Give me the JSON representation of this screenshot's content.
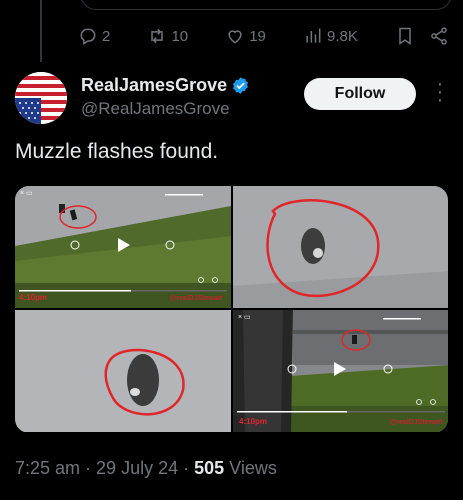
{
  "previous_tweet": {
    "actions": {
      "replies": "2",
      "retweets": "10",
      "likes": "19",
      "views": "9.8K"
    }
  },
  "tweet": {
    "author": {
      "display_name": "RealJamesGrove",
      "handle": "@RealJamesGrove",
      "verified": true
    },
    "follow_label": "Follow",
    "text": "Muzzle flashes found.",
    "media": [
      {
        "timestamp": "4:10pm",
        "watermark": "@realDJStewart"
      },
      {},
      {},
      {
        "timestamp": "4:10pm",
        "watermark": "@realDJStewart"
      }
    ],
    "meta": {
      "time": "7:25 am",
      "sep1": " · ",
      "date": "29 July 24",
      "sep2": " · ",
      "views_count": "505",
      "views_label": " Views"
    }
  },
  "colors": {
    "background": "#000000",
    "text_primary": "#e7e9ea",
    "text_secondary": "#71767b",
    "verified_blue": "#1d9bf0",
    "annotation_red": "#e0262a"
  }
}
